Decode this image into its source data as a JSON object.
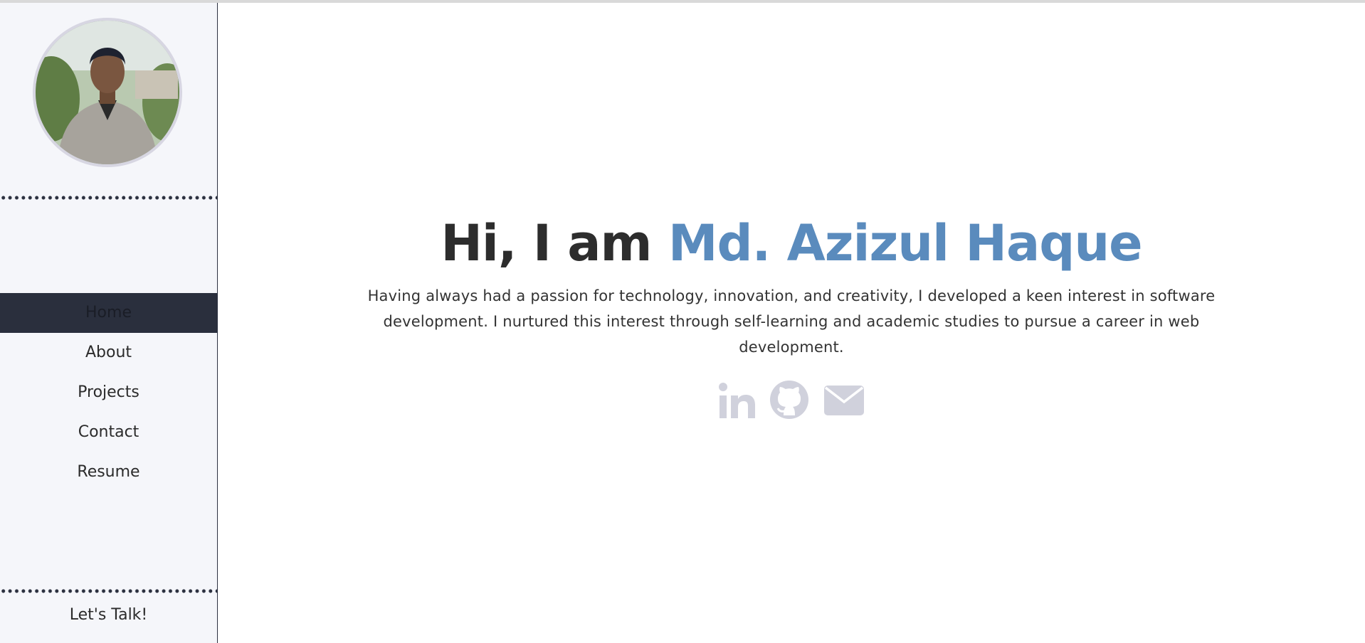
{
  "sidebar": {
    "avatar_alt": "Profile photo",
    "nav": [
      {
        "label": "Home",
        "active": true
      },
      {
        "label": "About",
        "active": false
      },
      {
        "label": "Projects",
        "active": false
      },
      {
        "label": "Contact",
        "active": false
      },
      {
        "label": "Resume",
        "active": false
      }
    ],
    "cta_label": "Let's Talk!"
  },
  "hero": {
    "greeting": "Hi, I am",
    "name": "Md. Azizul Haque",
    "bio": "Having always had a passion for technology, innovation, and creativity, I developed a keen interest in software development. I nurtured this interest through self-learning and academic studies to pursue a career in web development."
  },
  "socials": [
    {
      "icon": "linkedin-icon"
    },
    {
      "icon": "github-icon"
    },
    {
      "icon": "envelope-icon"
    }
  ],
  "colors": {
    "sidebar_bg": "#f5f6fa",
    "active_nav_bg": "#2a2f3d",
    "name_accent": "#5a8bbd",
    "icon_color": "#d0d1dc"
  }
}
